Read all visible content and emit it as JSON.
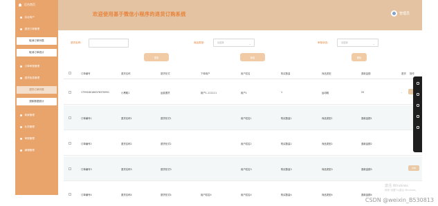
{
  "sidebar": {
    "logo": "后台首页",
    "items": [
      {
        "label": "后台用户",
        "type": "menu"
      },
      {
        "label": "退货订单管理",
        "type": "menu"
      },
      {
        "label": "取消订单列表",
        "type": "sub"
      },
      {
        "label": "取消订单统计",
        "type": "sub"
      },
      {
        "label": "订单审核管理",
        "type": "menu"
      },
      {
        "label": "退货信息管理",
        "type": "menu"
      },
      {
        "label": "退货订单列表",
        "type": "active"
      },
      {
        "label": "退款数据统计",
        "type": "sub"
      },
      {
        "label": "商家管理",
        "type": "menu"
      },
      {
        "label": "业务管理",
        "type": "menu"
      },
      {
        "label": "审核管理",
        "type": "menu"
      },
      {
        "label": "编辑管理",
        "type": "menu"
      }
    ]
  },
  "header": {
    "title": "欢迎使用基于微信小程序的退货订购系统",
    "user": "管理员"
  },
  "search": {
    "fields": [
      {
        "label": "退货名称:",
        "kind": "input",
        "placeholder": ""
      },
      {
        "label": "商品类型:",
        "kind": "select",
        "placeholder": "请选择"
      },
      {
        "label": "审核状态:",
        "kind": "select",
        "placeholder": "请选择"
      }
    ],
    "buttons": [
      "搜索",
      "新增",
      "删除"
    ]
  },
  "table": {
    "headers": [
      "订单编号",
      "退货名称",
      "退货形式",
      "下单用户",
      "用户姓名",
      "购买数量",
      "商品类型",
      "退款金额",
      "退货",
      "操作"
    ],
    "rows": [
      [
        "1799180166376376991",
        "小黑鞋1",
        "运费退货",
        "用户1-111111",
        "用户1",
        "1",
        "运动鞋",
        "25",
        "-",
        ""
      ],
      [
        "订单编号1",
        "退货名称1",
        "退货形式1",
        "",
        "用户姓名1",
        "购买数量1",
        "商品类型1",
        "退款金额1",
        "",
        ""
      ],
      [
        "订单编号2",
        "退货名称2",
        "退货形式2",
        "",
        "用户姓名2",
        "购买数量2",
        "商品类型2",
        "退款金额2",
        "",
        ""
      ],
      [
        "订单编号3",
        "退货名称3",
        "退货形式3",
        "",
        "用户姓名3",
        "购买数量3",
        "商品类型3",
        "退款金额3",
        "",
        "详情"
      ],
      [
        "订单编号4",
        "退货名称4",
        "退货形式4",
        "用户姓名4",
        "用户姓名4",
        "购买数量4",
        "商品类型4",
        "退款金额4",
        "",
        ""
      ]
    ]
  },
  "overlay": {
    "activate_windows": "激活 Windows",
    "activate_hint": "转到\"设置\"以激活 Windows。",
    "csdn": "CSDN @weixin_B530813"
  }
}
